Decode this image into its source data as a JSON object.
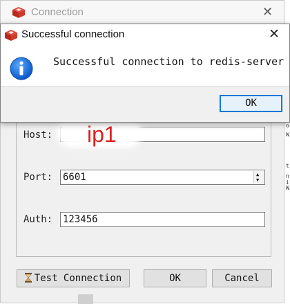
{
  "background_window": {
    "title": "Connection",
    "close_glyph": "✕",
    "form": {
      "host_label": "Host:",
      "host_value": "",
      "host_overlay_text": "ip1",
      "port_label": "Port:",
      "port_value": "6601",
      "auth_label": "Auth:",
      "auth_value": "123456"
    },
    "buttons": {
      "test_connection": "Test Connection",
      "ok": "OK",
      "cancel": "Cancel"
    }
  },
  "dialog": {
    "title": "Successful connection",
    "close_glyph": "✕",
    "message": "Successful connection to redis-server",
    "ok_label": "OK",
    "icon": "info-icon"
  },
  "background_app_fragments": [
    "o,",
    "Wi",
    "t,",
    "n",
    "i",
    "Wi"
  ],
  "colors": {
    "accent": "#0078d7",
    "info_blue": "#1a6fd8",
    "redis_red": "#d82c20",
    "overlay_red": "#e02020"
  }
}
